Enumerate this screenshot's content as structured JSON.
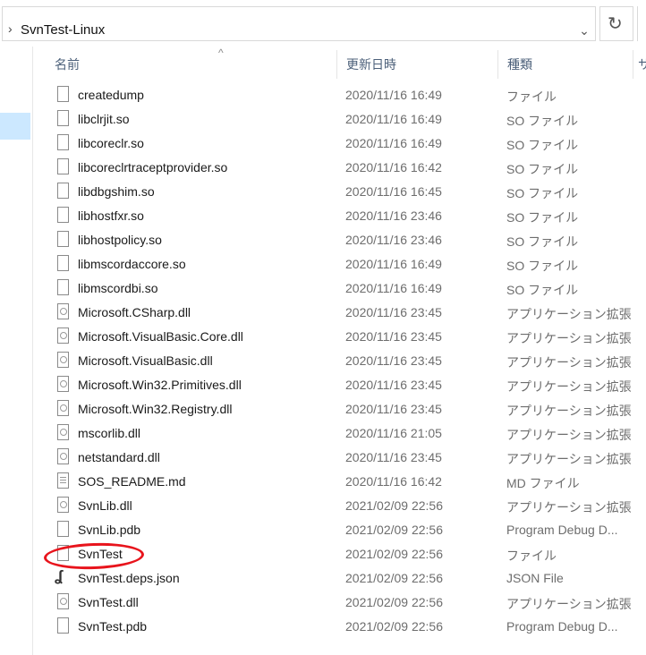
{
  "address": {
    "path": "SvnTest-Linux"
  },
  "columns": {
    "name": "名前",
    "date": "更新日時",
    "type": "種類",
    "size": "サ"
  },
  "files": [
    {
      "name": "createdump",
      "date": "2020/11/16 16:49",
      "type": "ファイル",
      "icon": "blank-file-icon"
    },
    {
      "name": "libclrjit.so",
      "date": "2020/11/16 16:49",
      "type": "SO ファイル",
      "icon": "blank-file-icon"
    },
    {
      "name": "libcoreclr.so",
      "date": "2020/11/16 16:49",
      "type": "SO ファイル",
      "icon": "blank-file-icon"
    },
    {
      "name": "libcoreclrtraceptprovider.so",
      "date": "2020/11/16 16:42",
      "type": "SO ファイル",
      "icon": "blank-file-icon"
    },
    {
      "name": "libdbgshim.so",
      "date": "2020/11/16 16:45",
      "type": "SO ファイル",
      "icon": "blank-file-icon"
    },
    {
      "name": "libhostfxr.so",
      "date": "2020/11/16 23:46",
      "type": "SO ファイル",
      "icon": "blank-file-icon"
    },
    {
      "name": "libhostpolicy.so",
      "date": "2020/11/16 23:46",
      "type": "SO ファイル",
      "icon": "blank-file-icon"
    },
    {
      "name": "libmscordaccore.so",
      "date": "2020/11/16 16:49",
      "type": "SO ファイル",
      "icon": "blank-file-icon"
    },
    {
      "name": "libmscordbi.so",
      "date": "2020/11/16 16:49",
      "type": "SO ファイル",
      "icon": "blank-file-icon"
    },
    {
      "name": "Microsoft.CSharp.dll",
      "date": "2020/11/16 23:45",
      "type": "アプリケーション拡張",
      "icon": "dll-file-icon"
    },
    {
      "name": "Microsoft.VisualBasic.Core.dll",
      "date": "2020/11/16 23:45",
      "type": "アプリケーション拡張",
      "icon": "dll-file-icon"
    },
    {
      "name": "Microsoft.VisualBasic.dll",
      "date": "2020/11/16 23:45",
      "type": "アプリケーション拡張",
      "icon": "dll-file-icon"
    },
    {
      "name": "Microsoft.Win32.Primitives.dll",
      "date": "2020/11/16 23:45",
      "type": "アプリケーション拡張",
      "icon": "dll-file-icon"
    },
    {
      "name": "Microsoft.Win32.Registry.dll",
      "date": "2020/11/16 23:45",
      "type": "アプリケーション拡張",
      "icon": "dll-file-icon"
    },
    {
      "name": "mscorlib.dll",
      "date": "2020/11/16 21:05",
      "type": "アプリケーション拡張",
      "icon": "dll-file-icon"
    },
    {
      "name": "netstandard.dll",
      "date": "2020/11/16 23:45",
      "type": "アプリケーション拡張",
      "icon": "dll-file-icon"
    },
    {
      "name": "SOS_README.md",
      "date": "2020/11/16 16:42",
      "type": "MD ファイル",
      "icon": "text-file-icon"
    },
    {
      "name": "SvnLib.dll",
      "date": "2021/02/09 22:56",
      "type": "アプリケーション拡張",
      "icon": "dll-file-icon"
    },
    {
      "name": "SvnLib.pdb",
      "date": "2021/02/09 22:56",
      "type": "Program Debug D...",
      "icon": "blank-file-icon"
    },
    {
      "name": "SvnTest",
      "date": "2021/02/09 22:56",
      "type": "ファイル",
      "icon": "blank-file-icon"
    },
    {
      "name": "SvnTest.deps.json",
      "date": "2021/02/09 22:56",
      "type": "JSON File",
      "icon": "json-file-icon"
    },
    {
      "name": "SvnTest.dll",
      "date": "2021/02/09 22:56",
      "type": "アプリケーション拡張",
      "icon": "dll-file-icon"
    },
    {
      "name": "SvnTest.pdb",
      "date": "2021/02/09 22:56",
      "type": "Program Debug D...",
      "icon": "blank-file-icon"
    }
  ],
  "annotation": {
    "color": "#e8141c"
  }
}
